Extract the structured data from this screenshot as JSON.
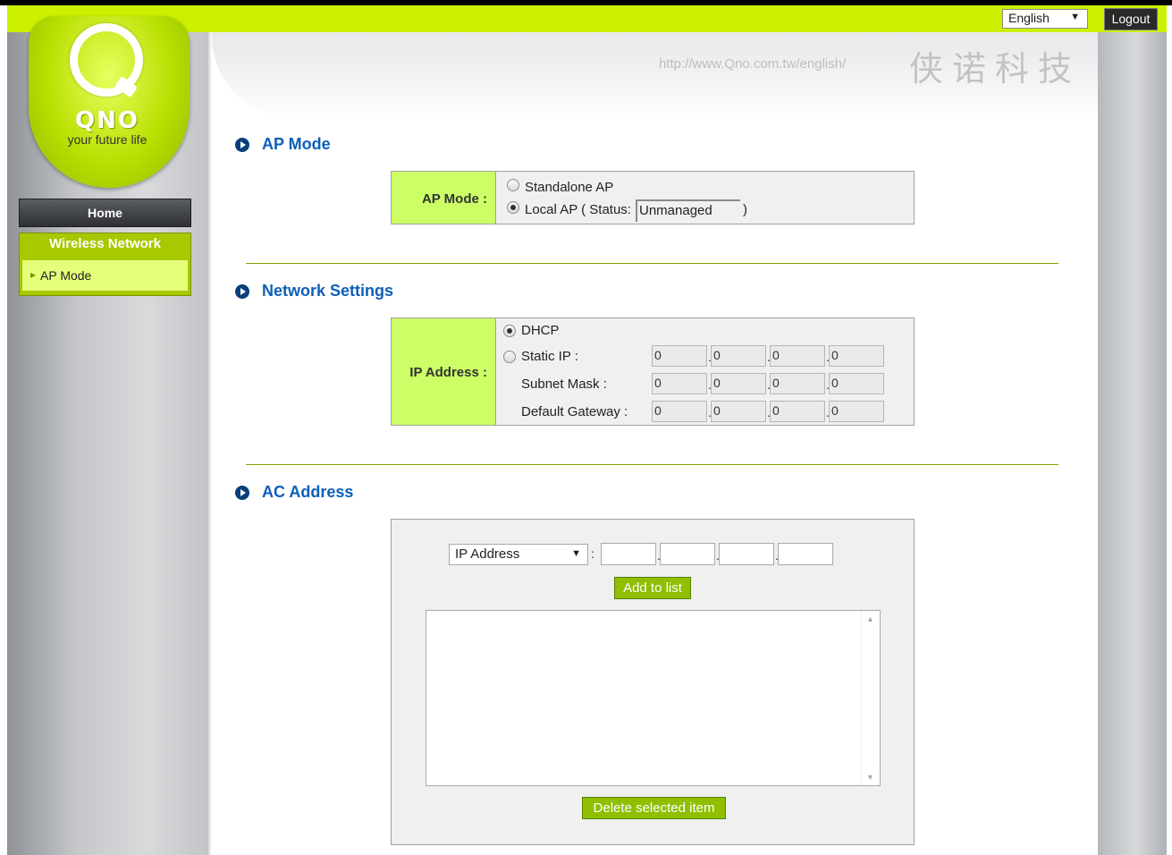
{
  "topbar": {
    "language": "English",
    "logout_label": "Logout"
  },
  "brand": {
    "logo_text": "QNO",
    "tagline": "your future life",
    "url": "http://www.Qno.com.tw/english/",
    "chinese_name": "侠诺科技"
  },
  "sidebar": {
    "home_label": "Home",
    "group_label": "Wireless Network",
    "items": [
      {
        "label": "AP Mode"
      }
    ]
  },
  "ap_mode": {
    "section_title": "AP Mode",
    "label": "AP Mode :",
    "options": [
      {
        "label": "Standalone AP",
        "selected": false
      },
      {
        "label": "Local AP ( Status:",
        "selected": true
      }
    ],
    "status_value": "Unmanaged",
    "status_close": ")"
  },
  "network": {
    "section_title": "Network Settings",
    "label": "IP Address :",
    "dhcp_label": "DHCP",
    "dhcp_selected": true,
    "static_label": "Static IP :",
    "static_selected": false,
    "subnet_label": "Subnet Mask :",
    "gateway_label": "Default Gateway :",
    "static_ip": [
      "0",
      "0",
      "0",
      "0"
    ],
    "subnet": [
      "0",
      "0",
      "0",
      "0"
    ],
    "gateway": [
      "0",
      "0",
      "0",
      "0"
    ],
    "separator": "."
  },
  "ac": {
    "section_title": "AC Address",
    "type_select": "IP Address",
    "colon": ":",
    "add_label": "Add to list",
    "delete_label": "Delete selected item",
    "scroll_up": "▲",
    "scroll_down": "▼"
  },
  "colors": {
    "accent_green": "#ccf000",
    "button_green": "#8fbf00",
    "title_blue": "#0d5fb8",
    "label_bg": "#ccff66"
  }
}
